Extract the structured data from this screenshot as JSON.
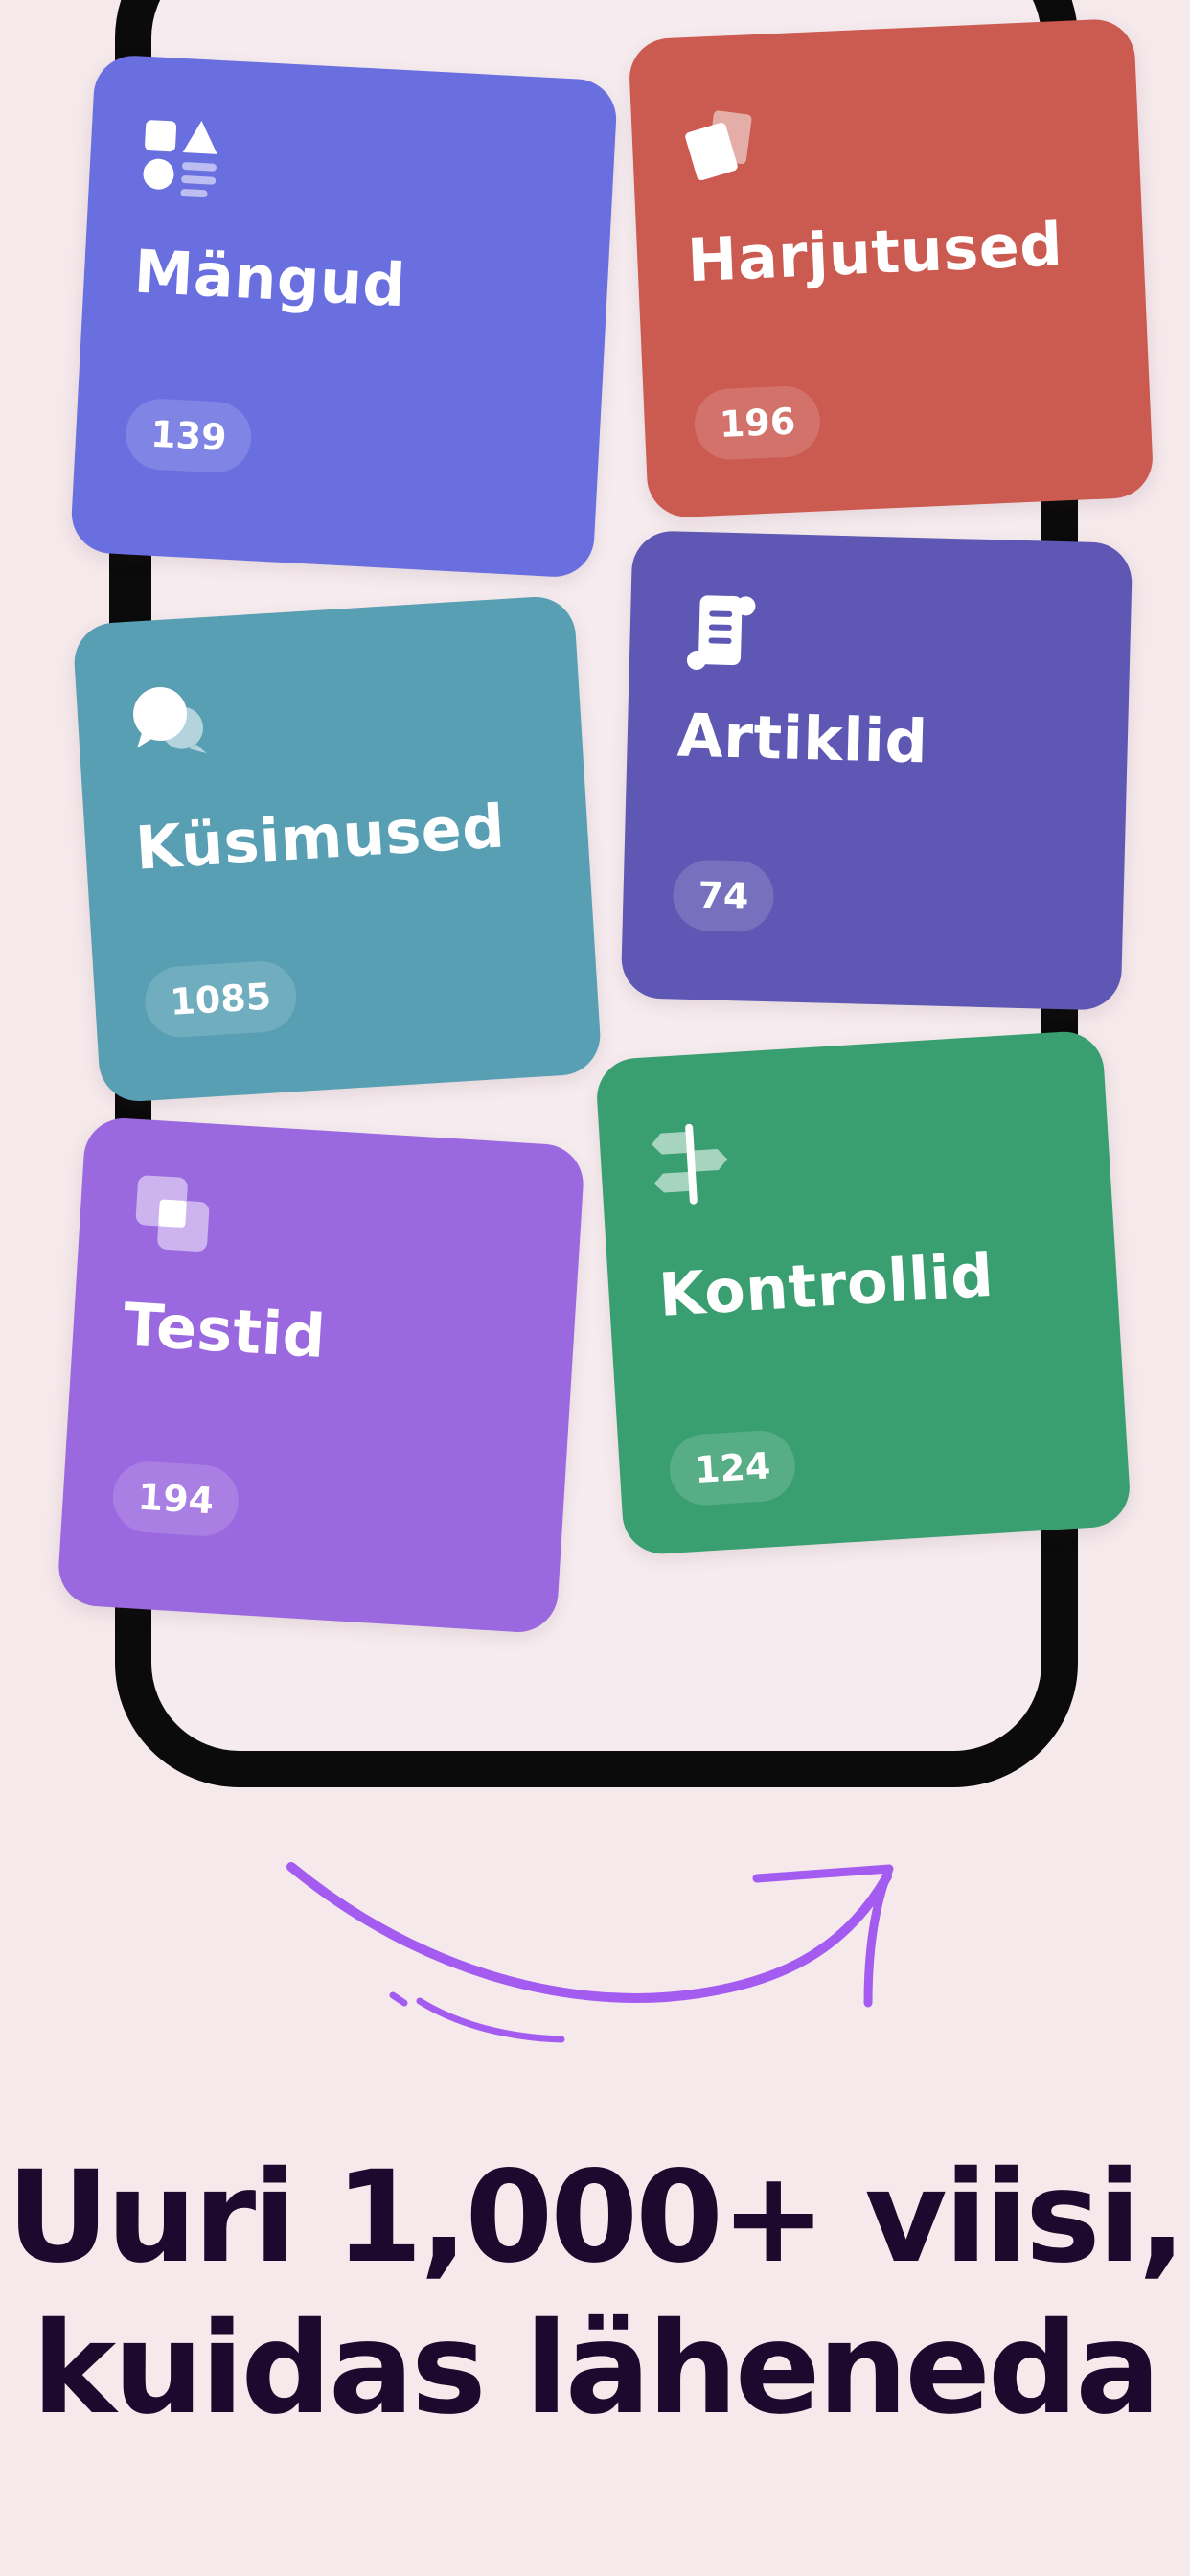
{
  "cards": [
    {
      "label": "Mängud",
      "count": "139",
      "icon": "shapes-icon",
      "color": "#6a6fe0"
    },
    {
      "label": "Harjutused",
      "count": "196",
      "icon": "cards-icon",
      "color": "#cb5a50"
    },
    {
      "label": "Küsimused",
      "count": "1085",
      "icon": "chat-bubbles-icon",
      "color": "#589fb4"
    },
    {
      "label": "Artiklid",
      "count": "74",
      "icon": "scroll-icon",
      "color": "#5e57b3"
    },
    {
      "label": "Testid",
      "count": "194",
      "icon": "overlap-squares-icon",
      "color": "#9b69df"
    },
    {
      "label": "Kontrollid",
      "count": "124",
      "icon": "signpost-icon",
      "color": "#3a9f70"
    }
  ],
  "headline": {
    "line1": "Uuri 1,000+ viisi,",
    "line2": "kuidas läheneda"
  },
  "colors": {
    "background": "#f5e9ec",
    "headline": "#1c0a2e",
    "arrow": "#a45cf0",
    "phone_frame": "#0b0b0b"
  }
}
